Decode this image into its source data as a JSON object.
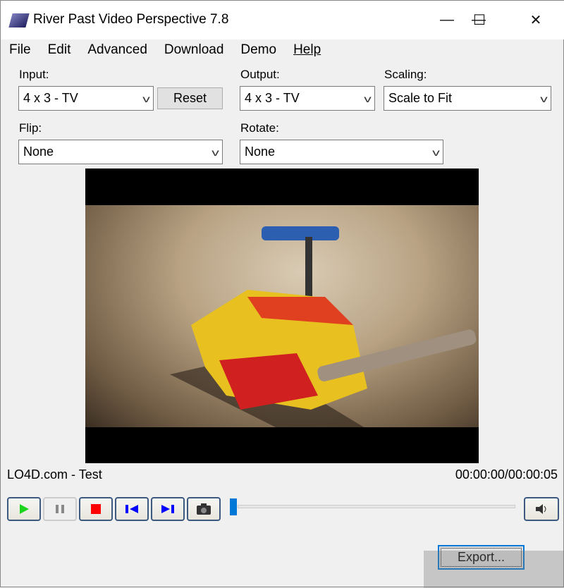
{
  "window": {
    "title": "River Past Video Perspective 7.8",
    "minimize": "—",
    "maximize": "☐",
    "close": "✕"
  },
  "menu": [
    "File",
    "Edit",
    "Advanced",
    "Download",
    "Demo",
    "Help"
  ],
  "controls": {
    "input_label": "Input:",
    "input_value": "4 x 3 - TV",
    "reset_label": "Reset",
    "output_label": "Output:",
    "output_value": "4 x 3 - TV",
    "scaling_label": "Scaling:",
    "scaling_value": "Scale to Fit",
    "flip_label": "Flip:",
    "flip_value": "None",
    "rotate_label": "Rotate:",
    "rotate_value": "None"
  },
  "status": {
    "title": "LO4D.com - Test",
    "time": "00:00:00/00:00:05"
  },
  "player": {
    "icons": [
      "play-icon",
      "pause-icon",
      "stop-icon",
      "skip-back-icon",
      "skip-forward-icon",
      "camera-icon",
      "volume-icon"
    ],
    "position": 0
  },
  "export_label": "Export...",
  "watermark": "LO4D.com"
}
